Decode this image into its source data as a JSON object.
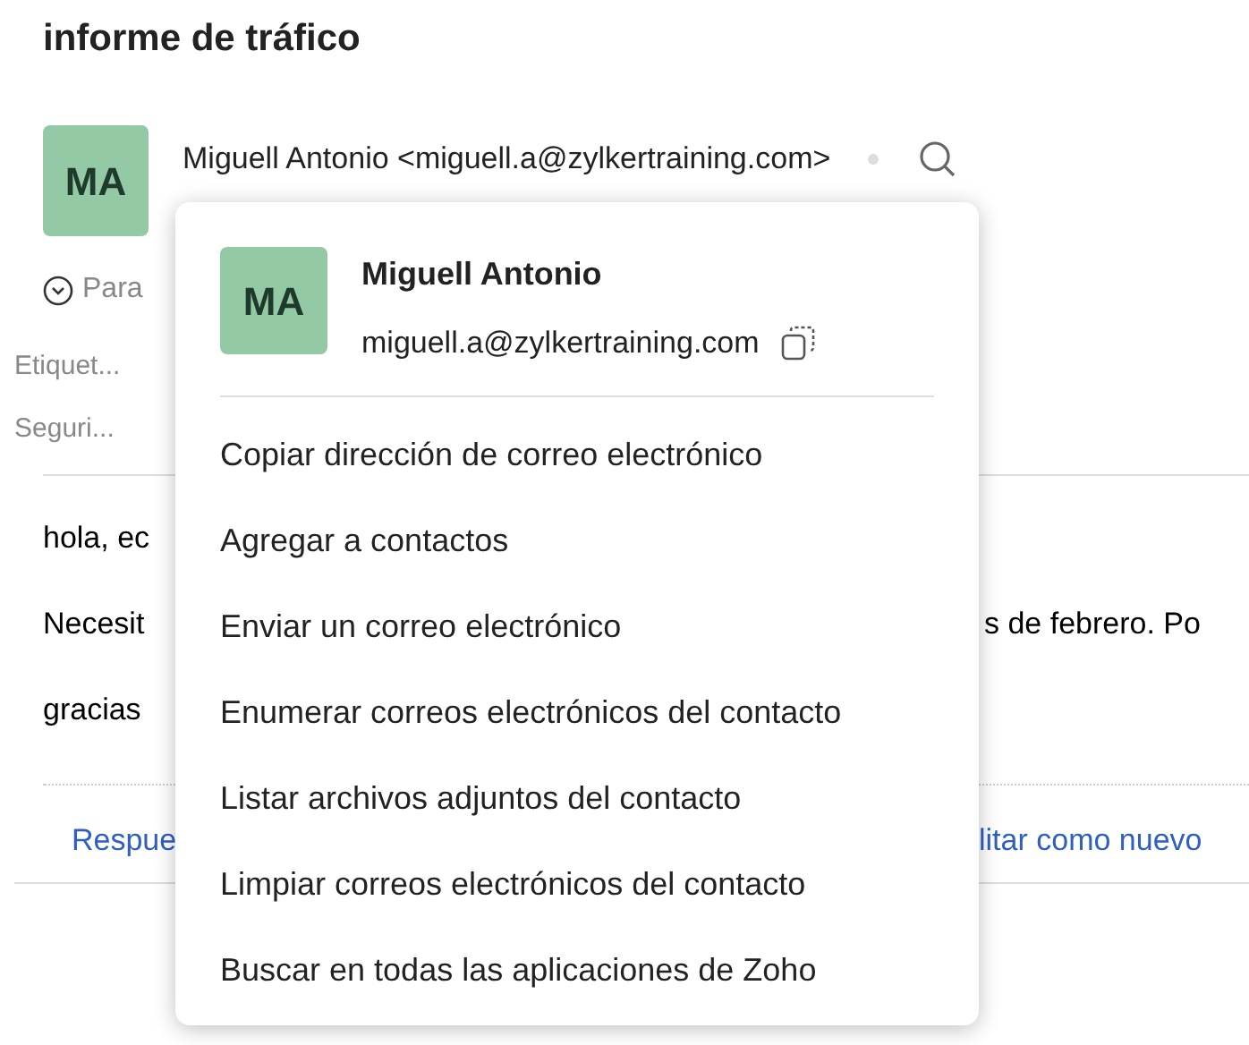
{
  "subject": "informe de tráfico",
  "sender": {
    "initials": "MA",
    "line": "Miguell Antonio <miguell.a@zylkertraining.com>"
  },
  "recipients_label": "Para",
  "meta": [
    "Etiquet...",
    "Seguri..."
  ],
  "body": [
    {
      "left": "hola, ec"
    },
    {
      "left": "Necesit",
      "right": "s de febrero. Po"
    },
    {
      "left": "gracias"
    }
  ],
  "actions": {
    "left": "Respue",
    "right": "litar como nuevo"
  },
  "contact_menu": {
    "initials": "MA",
    "name": "Miguell Antonio",
    "email": "miguell.a@zylkertraining.com",
    "items": [
      "Copiar dirección de correo electrónico",
      "Agregar a contactos",
      "Enviar un correo electrónico",
      "Enumerar correos electrónicos del contacto",
      "Listar archivos adjuntos del contacto",
      "Limpiar correos electrónicos del contacto",
      "Buscar en todas las aplicaciones de Zoho"
    ]
  }
}
